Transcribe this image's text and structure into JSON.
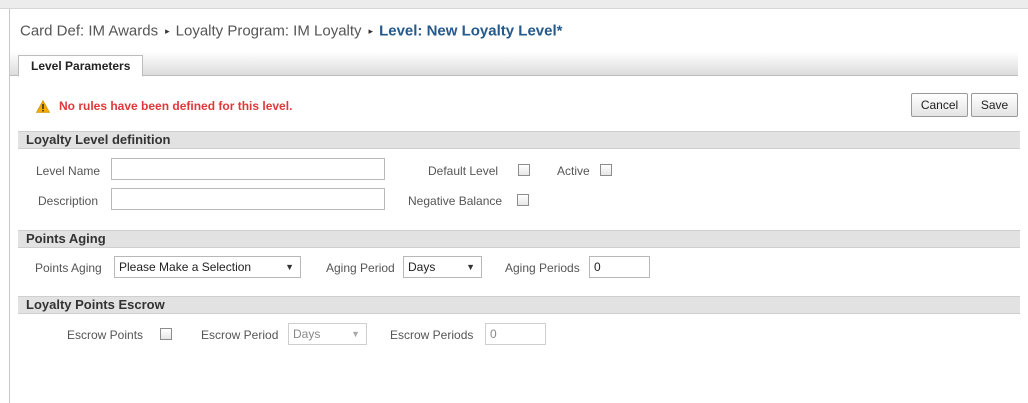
{
  "breadcrumb": {
    "items": [
      "Card Def: IM Awards",
      "Loyalty Program: IM Loyalty",
      "Level: New Loyalty Level*"
    ],
    "separator": "▸"
  },
  "tabs": [
    "Level Parameters"
  ],
  "warning": {
    "icon": "warning-triangle-icon",
    "text": "No rules have been defined for this level.",
    "color": "#e0383a"
  },
  "buttons": {
    "cancel": "Cancel",
    "save": "Save"
  },
  "sections": {
    "definition": {
      "title": "Loyalty Level definition",
      "level_name_label": "Level Name",
      "level_name_value": "",
      "description_label": "Description",
      "description_value": "",
      "default_level_label": "Default Level",
      "default_level_checked": false,
      "active_label": "Active",
      "active_checked": false,
      "negative_balance_label": "Negative Balance",
      "negative_balance_checked": false
    },
    "aging": {
      "title": "Points Aging",
      "points_aging_label": "Points Aging",
      "points_aging_value": "Please Make a Selection",
      "aging_period_label": "Aging Period",
      "aging_period_value": "Days",
      "aging_periods_label": "Aging Periods",
      "aging_periods_value": "0"
    },
    "escrow": {
      "title": "Loyalty Points Escrow",
      "escrow_points_label": "Escrow Points",
      "escrow_points_checked": false,
      "escrow_period_label": "Escrow Period",
      "escrow_period_value": "Days",
      "escrow_periods_label": "Escrow Periods",
      "escrow_periods_value": "0"
    }
  },
  "colors": {
    "accent": "#24598c",
    "section_bg": "#e2e2e2"
  }
}
